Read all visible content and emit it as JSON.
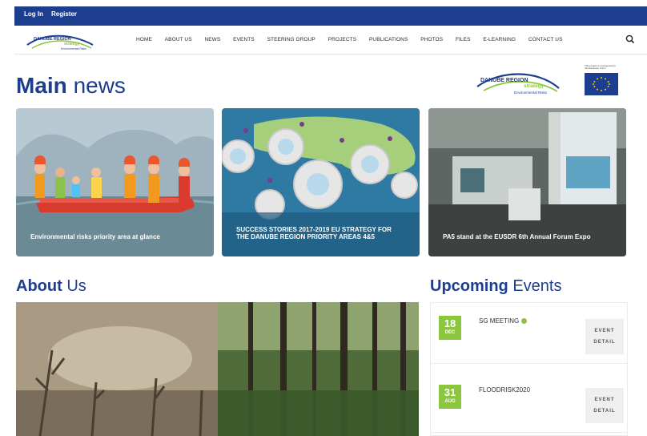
{
  "topbar": {
    "login": "Log In",
    "register": "Register"
  },
  "brand": {
    "logo_line1": "DANUBE REGION",
    "logo_line2": "strategy",
    "logo_line3": "Environmental Risks"
  },
  "nav": {
    "items": [
      "HOME",
      "ABOUT US",
      "NEWS",
      "EVENTS",
      "STEERING GROUP",
      "PROJECTS",
      "PUBLICATIONS",
      "PHOTOS",
      "FILES",
      "E-LEARNING",
      "CONTACT US"
    ],
    "search_icon": "search-icon"
  },
  "main_news": {
    "title_bold": "Main",
    "title_rest": "news",
    "eu_caption": "This project is co-financed by the European Union",
    "cards": [
      {
        "caption": "Environmental risks priority area at glance"
      },
      {
        "caption": "SUCCESS STORIES 2017-2019 EU STRATEGY FOR THE DANUBE REGION PRIORITY AREAS 4&5"
      },
      {
        "caption": "PA5 stand at the EUSDR 6th Annual Forum Expo"
      }
    ]
  },
  "about": {
    "title_bold": "About",
    "title_rest": "Us"
  },
  "events": {
    "title_bold": "Upcoming",
    "title_rest": "Events",
    "items": [
      {
        "day": "18",
        "month": "DEC",
        "name": "SG MEETING",
        "button": "EVENT DETAIL"
      },
      {
        "day": "31",
        "month": "AUG",
        "name": "FLOODRISK2020",
        "button": "EVENT DETAIL"
      }
    ]
  },
  "colors": {
    "brand_blue": "#1d3e8e",
    "accent_green": "#8cc63f"
  }
}
